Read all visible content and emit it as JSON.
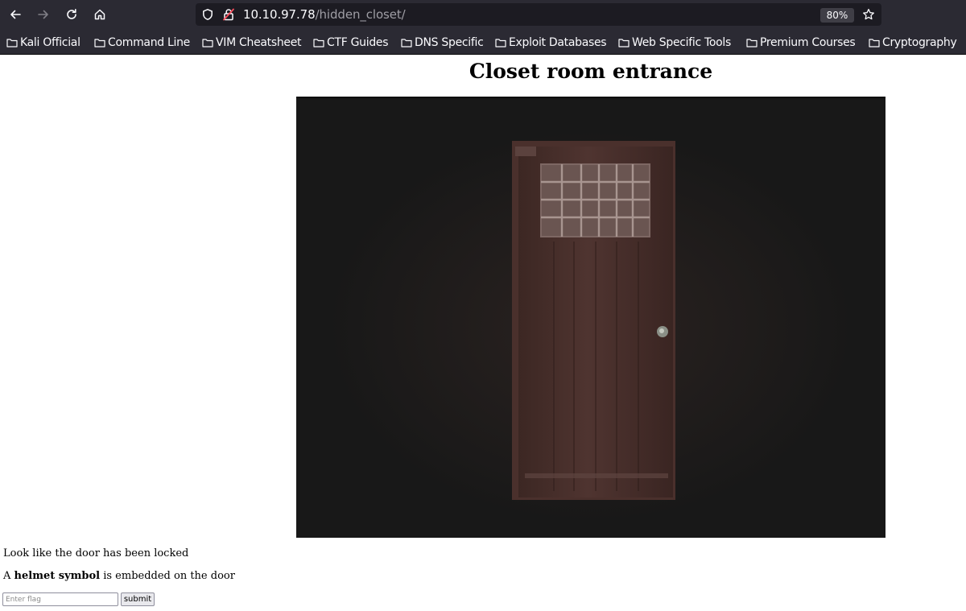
{
  "browser": {
    "url_host": "10.10.97.78",
    "url_path": "/hidden_closet/",
    "zoom": "80%",
    "icons": {
      "back": "arrow-left-icon",
      "forward": "arrow-right-icon",
      "reload": "reload-icon",
      "home": "home-icon",
      "tracking": "shield-icon",
      "lock": "lock-insecure-icon",
      "bookmark": "star-icon",
      "folder": "folder-icon"
    },
    "colors": {
      "chrome_bg": "#2b2a33",
      "urlbar_bg": "#1c1b22",
      "text": "#fbfbfe"
    }
  },
  "bookmarks": [
    {
      "label": "Kali Official"
    },
    {
      "label": "Command Line"
    },
    {
      "label": "VIM Cheatsheet"
    },
    {
      "label": "CTF Guides"
    },
    {
      "label": "DNS Specific"
    },
    {
      "label": "Exploit Databases"
    },
    {
      "label": "Web Specific Tools"
    },
    {
      "label": "Premium Courses"
    },
    {
      "label": "Cryptography"
    }
  ],
  "page": {
    "title": "Closet room entrance",
    "message": "Look like the door has been locked",
    "hint_prefix": "A ",
    "hint_bold": "helmet symbol",
    "hint_suffix": " is embedded on the door",
    "flag_input": {
      "placeholder": "Enter flag",
      "value": ""
    },
    "submit_label": "submit"
  }
}
